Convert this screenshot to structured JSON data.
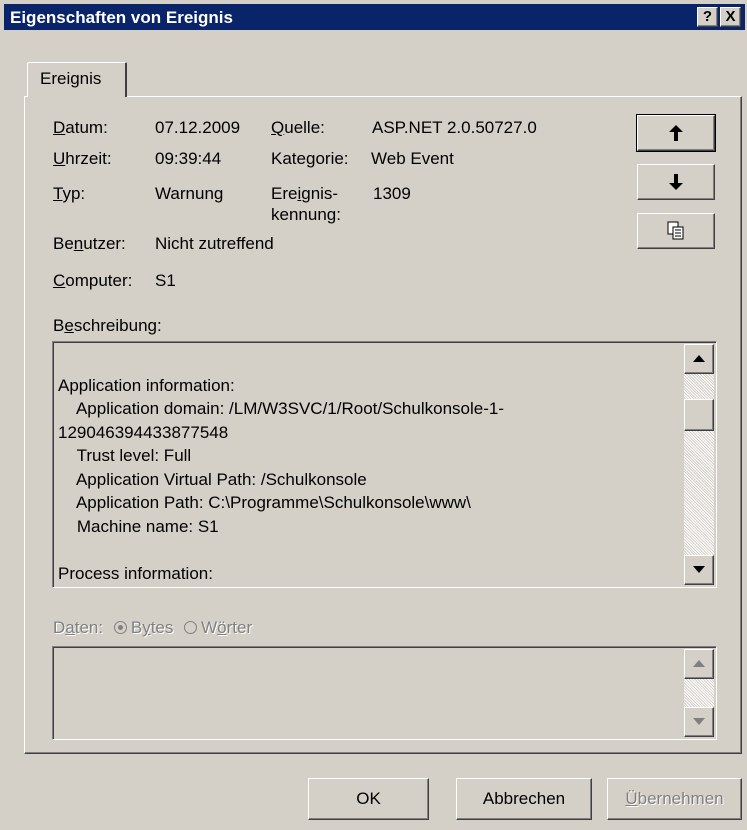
{
  "window": {
    "title": "Eigenschaften von Ereignis",
    "help_btn": "?",
    "close_btn": "X"
  },
  "tab": {
    "label": "Ereignis"
  },
  "fields": {
    "datum_label": "Datum:",
    "datum_value": "07.12.2009",
    "uhrzeit_label": "Uhrzeit:",
    "uhrzeit_value": "09:39:44",
    "typ_label": "Typ:",
    "typ_value": "Warnung",
    "quelle_label": "Quelle:",
    "quelle_value": "ASP.NET 2.0.50727.0",
    "kategorie_label": "Kategorie:",
    "kategorie_value": "Web Event",
    "kennung_label_1": "Ereignis-",
    "kennung_label_2": "kennung:",
    "kennung_value": "1309",
    "benutzer_label": "Benutzer:",
    "benutzer_value": "Nicht zutreffend",
    "computer_label": "Computer:",
    "computer_value": "S1"
  },
  "nav_buttons": {
    "up_icon": "arrow-up",
    "down_icon": "arrow-down",
    "copy_icon": "copy"
  },
  "description": {
    "label": "Beschreibung:",
    "text": "\nApplication information:\n    Application domain: /LM/W3SVC/1/Root/Schulkonsole-1-\n129046394433877548\n    Trust level: Full\n    Application Virtual Path: /Schulkonsole\n    Application Path: C:\\Programme\\Schulkonsole\\www\\\n    Machine name: S1\n\nProcess information:"
  },
  "data_section": {
    "label": "Daten:",
    "option_bytes": "Bytes",
    "option_words": "Wörter",
    "selected": "Bytes"
  },
  "footer": {
    "ok": "OK",
    "cancel": "Abbrechen",
    "apply": "Übernehmen"
  }
}
